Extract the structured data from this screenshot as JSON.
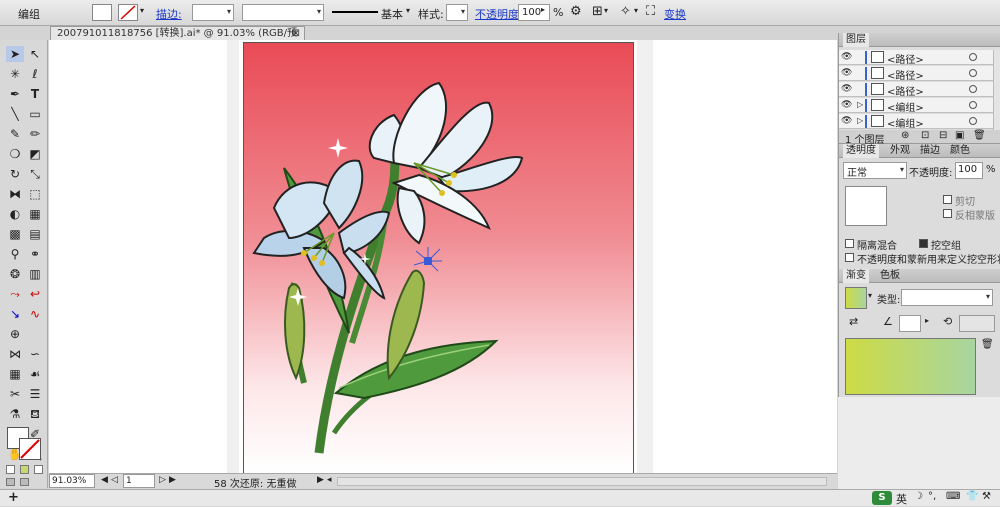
{
  "control_bar": {
    "selection_label": "编组",
    "stroke_label": "描边:",
    "stroke_style": "基本",
    "style_label": "样式:",
    "opacity_label": "不透明度:",
    "opacity_value": "100",
    "opacity_unit": "%",
    "transform_label": "变换"
  },
  "document_tab": {
    "title": "200791011818756 [转换].ai* @ 91.03% (RGB/预览)",
    "close": "⊠"
  },
  "status": {
    "zoom": "91.03%",
    "page": "1",
    "history": "58 次还原: 无重做"
  },
  "layers_panel": {
    "tab": "图层",
    "rows": [
      {
        "name": "<路径>"
      },
      {
        "name": "<路径>"
      },
      {
        "name": "<路径>"
      },
      {
        "name": "<编组>"
      },
      {
        "name": "<编组>"
      }
    ],
    "count": "1 个图层"
  },
  "transparency_panel": {
    "tabs": [
      "透明度",
      "外观",
      "描边",
      "颜色"
    ],
    "blend_mode": "正常",
    "opacity_label": "不透明度:",
    "opacity_value": "100",
    "opacity_unit": "%",
    "clip_label": "剪切",
    "invert_label": "反相蒙版",
    "isolate_label": "隔离混合",
    "knockout_label": "挖空组",
    "define_label": "不透明度和蒙新用来定义挖空形状"
  },
  "gradient_panel": {
    "tabs": [
      "渐变",
      "色板"
    ],
    "type_label": "类型:",
    "start_color": "#cddb45",
    "end_color": "#a8d5a0"
  },
  "taskbar": {
    "ime_label": "英"
  },
  "colors": {
    "artboard_top": "#e94b56",
    "artboard_bottom": "#ffffff",
    "link_blue": "#1a38c8"
  }
}
